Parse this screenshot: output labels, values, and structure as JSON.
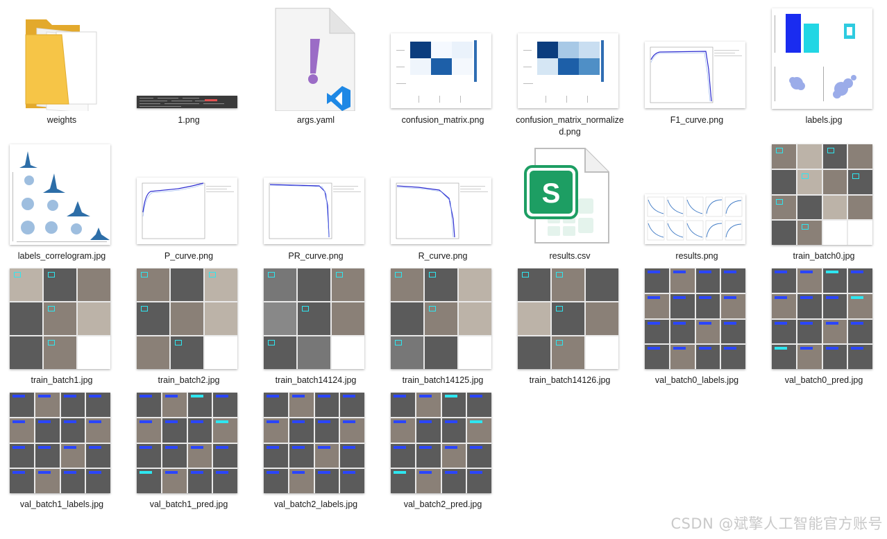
{
  "files": [
    {
      "name": "weights",
      "icon": "folder-icon"
    },
    {
      "name": "1.png",
      "icon": "image-thumbnail"
    },
    {
      "name": "args.yaml",
      "icon": "yaml-file-icon"
    },
    {
      "name": "confusion_matrix.png",
      "icon": "image-thumbnail"
    },
    {
      "name": "confusion_matrix_normalized.png",
      "icon": "image-thumbnail"
    },
    {
      "name": "F1_curve.png",
      "icon": "image-thumbnail"
    },
    {
      "name": "labels.jpg",
      "icon": "image-thumbnail"
    },
    {
      "name": "labels_correlogram.jpg",
      "icon": "image-thumbnail"
    },
    {
      "name": "P_curve.png",
      "icon": "image-thumbnail"
    },
    {
      "name": "PR_curve.png",
      "icon": "image-thumbnail"
    },
    {
      "name": "R_curve.png",
      "icon": "image-thumbnail"
    },
    {
      "name": "results.csv",
      "icon": "spreadsheet-file-icon"
    },
    {
      "name": "results.png",
      "icon": "image-thumbnail"
    },
    {
      "name": "train_batch0.jpg",
      "icon": "image-thumbnail"
    },
    {
      "name": "train_batch1.jpg",
      "icon": "image-thumbnail"
    },
    {
      "name": "train_batch2.jpg",
      "icon": "image-thumbnail"
    },
    {
      "name": "train_batch14124.jpg",
      "icon": "image-thumbnail"
    },
    {
      "name": "train_batch14125.jpg",
      "icon": "image-thumbnail"
    },
    {
      "name": "train_batch14126.jpg",
      "icon": "image-thumbnail"
    },
    {
      "name": "val_batch0_labels.jpg",
      "icon": "image-thumbnail"
    },
    {
      "name": "val_batch0_pred.jpg",
      "icon": "image-thumbnail"
    },
    {
      "name": "val_batch1_labels.jpg",
      "icon": "image-thumbnail"
    },
    {
      "name": "val_batch1_pred.jpg",
      "icon": "image-thumbnail"
    },
    {
      "name": "val_batch2_labels.jpg",
      "icon": "image-thumbnail"
    },
    {
      "name": "val_batch2_pred.jpg",
      "icon": "image-thumbnail"
    }
  ],
  "watermark": "CSDN @斌擎人工智能官方账号",
  "colors": {
    "folder": "#f6c547",
    "excel": "#1d9e63",
    "vscode": "#1e88e5",
    "yaml_mark": "#9b6cc6"
  }
}
